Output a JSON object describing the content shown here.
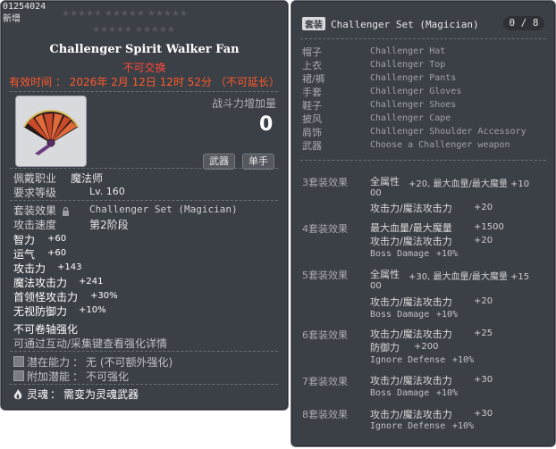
{
  "item": {
    "id_code": "01254024",
    "new_tag": "新增",
    "star_rows": [
      "★★★★★ ★★★★★ ★★★★★",
      "★★★★★ ★★★★★"
    ],
    "name": "Challenger Spirit Walker Fan",
    "tradable": "不可交换",
    "expiry": "有效时间 ： 2026年 2月 12日 12时 52分 （不可延长）",
    "power_label": "战斗力增加量",
    "power_value": "0",
    "tags": [
      "武器",
      "单手"
    ],
    "job_label": "佩戴职业",
    "job_value": "魔法师",
    "level_label": "要求等级",
    "level_value": "Lv. 160",
    "set_label": "套装效果",
    "set_value": "Challenger Set (Magician)",
    "speed_label": "攻击速度",
    "speed_value": "第2阶段",
    "stats": [
      {
        "label": "智力",
        "value": "+60"
      },
      {
        "label": "运气",
        "value": "+60"
      },
      {
        "label": "攻击力",
        "value": "+143"
      },
      {
        "label": "魔法攻击力",
        "value": "+241"
      },
      {
        "label": "首领怪攻击力",
        "value": "+30%"
      },
      {
        "label": "无视防御力",
        "value": "+10%"
      }
    ],
    "no_scroll": "不可卷轴强化",
    "enhance_hint": "可通过互动/采集键查看强化详情",
    "potential_label": "潜在能力",
    "potential_value": "无 (不可额外强化)",
    "bonus_label": "附加潜能",
    "bonus_value": "不可强化",
    "soul_label": "灵魂",
    "soul_value": "需变为灵魂武器",
    "colon": "："
  },
  "set": {
    "badge": "套装",
    "title": "Challenger Set (Magician)",
    "count": "0 / 8",
    "slots": [
      {
        "label": "帽子",
        "value": "Challenger Hat"
      },
      {
        "label": "上衣",
        "value": "Challenger Top"
      },
      {
        "label": "裙/裤",
        "value": "Challenger Pants"
      },
      {
        "label": "手套",
        "value": "Challenger Gloves"
      },
      {
        "label": "鞋子",
        "value": "Challenger Shoes"
      },
      {
        "label": "披风",
        "value": "Challenger Cape"
      },
      {
        "label": "肩饰",
        "value": "Challenger Shoulder Accessory"
      },
      {
        "label": "武器",
        "value": "Choose a Challenger weapon"
      }
    ],
    "effects": [
      {
        "label": "3套装效果",
        "lines": [
          {
            "name": "全属性",
            "value": "+20, 最大血量/最大魔量 +10"
          },
          {
            "name": "00",
            "value": ""
          },
          {
            "name": "攻击力/魔法攻击力",
            "value": "+20"
          }
        ]
      },
      {
        "label": "4套装效果",
        "lines": [
          {
            "name": "最大血量/最大魔量",
            "value": "+1500"
          },
          {
            "name": "攻击力/魔法攻击力",
            "value": "+20"
          },
          {
            "name": "Boss Damage",
            "value": "+10%"
          }
        ]
      },
      {
        "label": "5套装效果",
        "lines": [
          {
            "name": "全属性",
            "value": "+30, 最大血量/最大魔量 +15"
          },
          {
            "name": "00",
            "value": ""
          },
          {
            "name": "攻击力/魔法攻击力",
            "value": "+20"
          },
          {
            "name": "Boss Damage",
            "value": "+10%"
          }
        ]
      },
      {
        "label": "6套装效果",
        "lines": [
          {
            "name": "攻击力/魔法攻击力",
            "value": "+25"
          },
          {
            "name": "防御力",
            "value": "+200"
          },
          {
            "name": "Ignore Defense",
            "value": "+10%"
          }
        ]
      },
      {
        "label": "7套装效果",
        "lines": [
          {
            "name": "攻击力/魔法攻击力",
            "value": "+30"
          },
          {
            "name": "Boss Damage",
            "value": "+10%"
          }
        ]
      },
      {
        "label": "8套装效果",
        "lines": [
          {
            "name": "攻击力/魔法攻击力",
            "value": "+30"
          },
          {
            "name": "Ignore Defense",
            "value": "+10%"
          }
        ]
      }
    ]
  },
  "colors": {
    "panel_bg": "#3b3f46",
    "accent_red": "#ff4a3a",
    "accent_orange": "#ffb13a",
    "title_white": "#ffffff"
  }
}
